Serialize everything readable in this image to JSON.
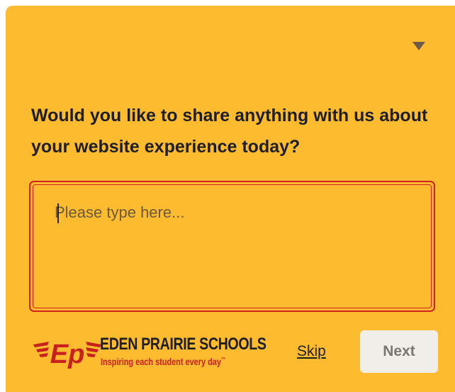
{
  "survey": {
    "question": "Would you like to share anything with us about your website experience today?",
    "input_placeholder": "Please type here...",
    "input_value": "",
    "skip_label": "Skip",
    "next_label": "Next",
    "collapse_icon": "caret-down-icon"
  },
  "branding": {
    "logo_letters": "Ep",
    "name": "EDEN PRAIRIE SCHOOLS",
    "tagline": "Inspiring each student every day",
    "trademark": "™"
  },
  "colors": {
    "panel_background": "#fdbb30",
    "focus_border": "#d0221e",
    "brand_red": "#c8211d",
    "text": "#1e1e1e",
    "next_button_bg": "#f1ede8",
    "next_button_text": "#7a7670"
  }
}
